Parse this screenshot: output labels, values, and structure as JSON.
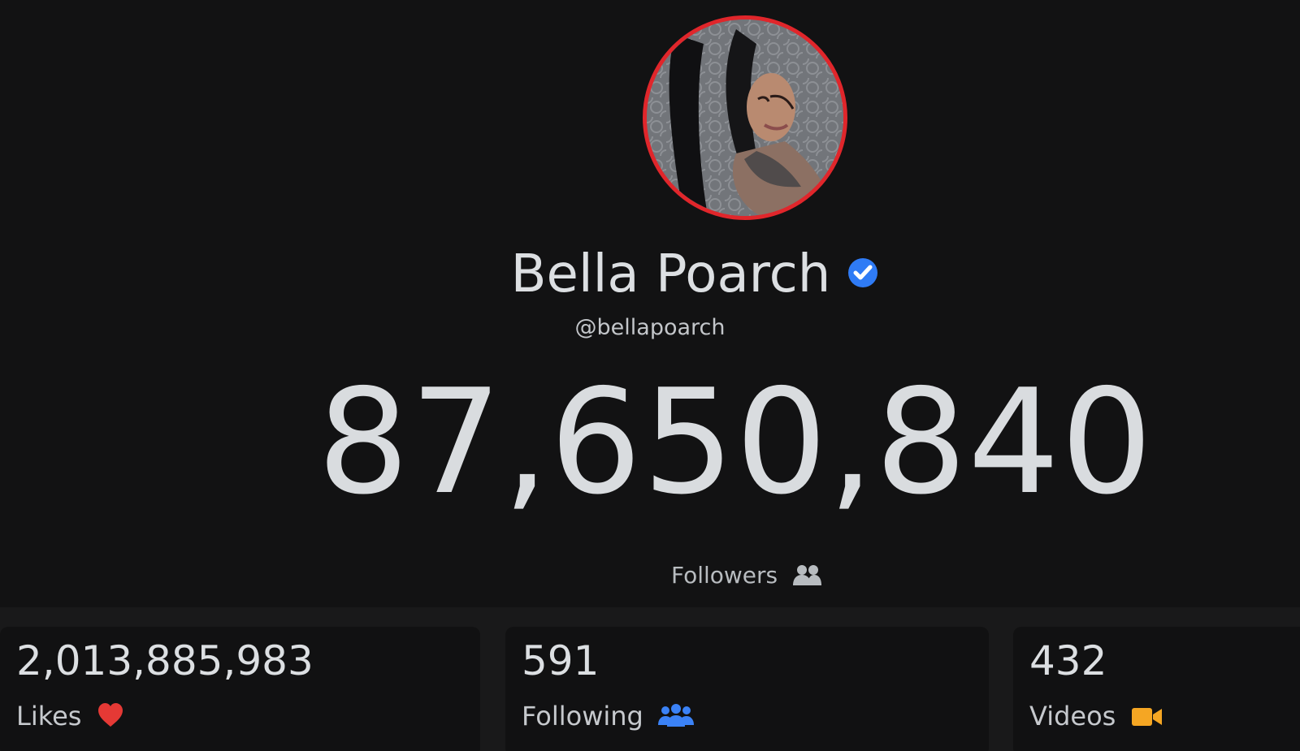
{
  "profile": {
    "display_name": "Bella Poarch",
    "handle": "@bellapoarch",
    "verified_icon": "verified-check-icon",
    "avatar_ring_color": "#e0262b"
  },
  "followers": {
    "count": "87,650,840",
    "label": "Followers",
    "icon": "users-icon"
  },
  "stats": [
    {
      "value": "2,013,885,983",
      "label": "Likes",
      "icon": "heart-icon",
      "icon_color": "#e53935"
    },
    {
      "value": "591",
      "label": "Following",
      "icon": "users-icon",
      "icon_color": "#3b82f6"
    },
    {
      "value": "432",
      "label": "Videos",
      "icon": "video-camera-icon",
      "icon_color": "#f5a623"
    }
  ],
  "colors": {
    "background": "#121213",
    "verified": "#2f7bf5",
    "text": "#d9dcdf"
  }
}
